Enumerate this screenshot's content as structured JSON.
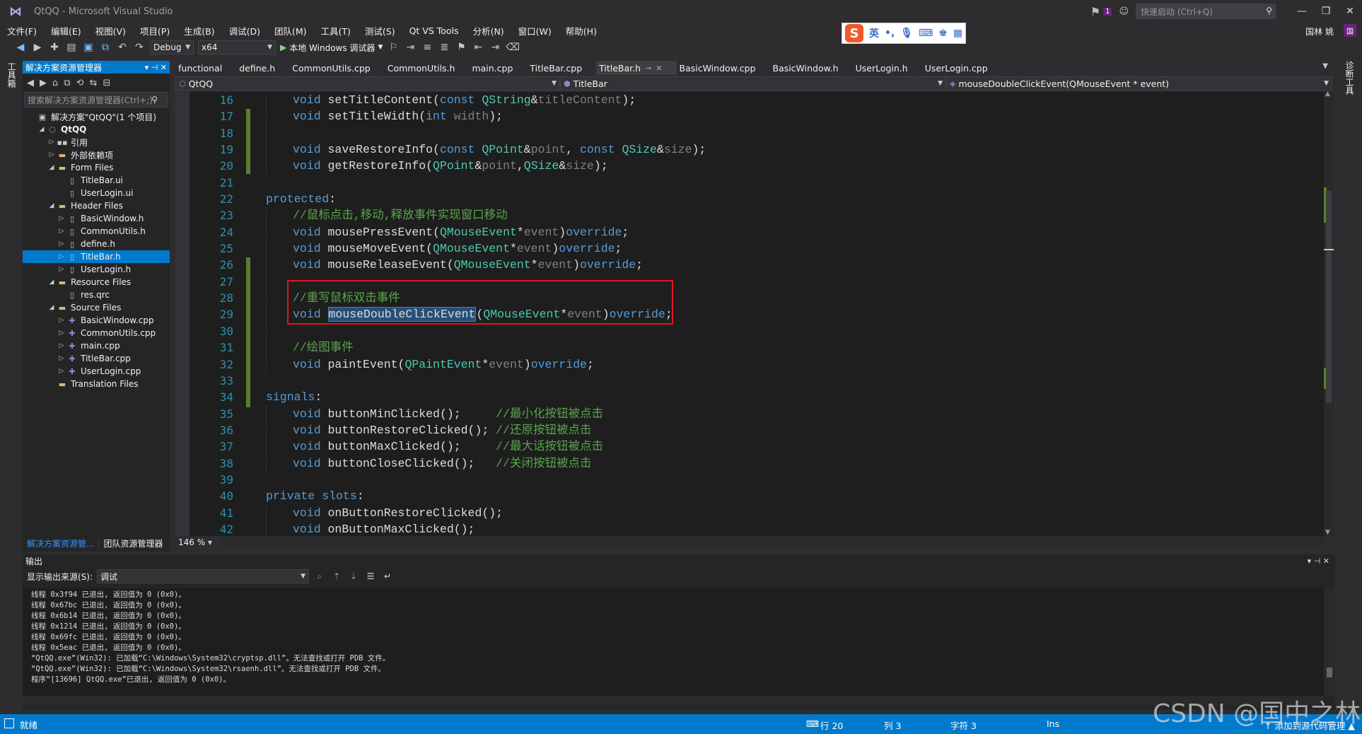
{
  "window": {
    "title": "QtQQ - Microsoft Visual Studio",
    "notification_count": "1",
    "quick_launch_placeholder": "快速启动 (Ctrl+Q)",
    "user_name": "国林 姚",
    "user_initial": "国"
  },
  "menu": [
    "文件(F)",
    "编辑(E)",
    "视图(V)",
    "项目(P)",
    "生成(B)",
    "调试(D)",
    "团队(M)",
    "工具(T)",
    "测试(S)",
    "Qt VS Tools",
    "分析(N)",
    "窗口(W)",
    "帮助(H)"
  ],
  "ime": {
    "logo": "S",
    "mode": "英"
  },
  "toolbar": {
    "config": "Debug",
    "platform": "x64",
    "run_label": "本地 Windows 调试器"
  },
  "left_strip": {
    "label": "工具箱"
  },
  "right_strip": {
    "label": "诊断工具"
  },
  "solution_explorer": {
    "title": "解决方案资源管理器",
    "search_placeholder": "搜索解决方案资源管理器(Ctrl+;)",
    "items": [
      {
        "label": "解决方案\"QtQQ\"(1 个项目)",
        "indent": 0,
        "twisty": "",
        "icon": "sol"
      },
      {
        "label": "QtQQ",
        "indent": 1,
        "twisty": "◢",
        "icon": "proj"
      },
      {
        "label": "引用",
        "indent": 2,
        "twisty": "▷",
        "icon": "ref"
      },
      {
        "label": "外部依赖项",
        "indent": 2,
        "twisty": "▷",
        "icon": "folder"
      },
      {
        "label": "Form Files",
        "indent": 2,
        "twisty": "◢",
        "icon": "folder"
      },
      {
        "label": "TitleBar.ui",
        "indent": 3,
        "twisty": "",
        "icon": "file"
      },
      {
        "label": "UserLogin.ui",
        "indent": 3,
        "twisty": "",
        "icon": "file"
      },
      {
        "label": "Header Files",
        "indent": 2,
        "twisty": "◢",
        "icon": "folder"
      },
      {
        "label": "BasicWindow.h",
        "indent": 3,
        "twisty": "▷",
        "icon": "file"
      },
      {
        "label": "CommonUtils.h",
        "indent": 3,
        "twisty": "▷",
        "icon": "file"
      },
      {
        "label": "define.h",
        "indent": 3,
        "twisty": "▷",
        "icon": "file"
      },
      {
        "label": "TitleBar.h",
        "indent": 3,
        "twisty": "▷",
        "icon": "file",
        "selected": true
      },
      {
        "label": "UserLogin.h",
        "indent": 3,
        "twisty": "▷",
        "icon": "file"
      },
      {
        "label": "Resource Files",
        "indent": 2,
        "twisty": "◢",
        "icon": "folder"
      },
      {
        "label": "res.qrc",
        "indent": 3,
        "twisty": "",
        "icon": "file"
      },
      {
        "label": "Source Files",
        "indent": 2,
        "twisty": "◢",
        "icon": "folder"
      },
      {
        "label": "BasicWindow.cpp",
        "indent": 3,
        "twisty": "▷",
        "icon": "cpp"
      },
      {
        "label": "CommonUtils.cpp",
        "indent": 3,
        "twisty": "▷",
        "icon": "cpp"
      },
      {
        "label": "main.cpp",
        "indent": 3,
        "twisty": "▷",
        "icon": "cpp"
      },
      {
        "label": "TitleBar.cpp",
        "indent": 3,
        "twisty": "▷",
        "icon": "cpp"
      },
      {
        "label": "UserLogin.cpp",
        "indent": 3,
        "twisty": "▷",
        "icon": "cpp"
      },
      {
        "label": "Translation Files",
        "indent": 2,
        "twisty": "",
        "icon": "folder"
      }
    ],
    "bottom_tabs": [
      "解决方案资源管...",
      "团队资源管理器"
    ]
  },
  "editor": {
    "tabs": [
      {
        "label": "functional"
      },
      {
        "label": "define.h"
      },
      {
        "label": "CommonUtils.cpp"
      },
      {
        "label": "CommonUtils.h"
      },
      {
        "label": "main.cpp"
      },
      {
        "label": "TitleBar.cpp"
      },
      {
        "label": "TitleBar.h",
        "active": true
      },
      {
        "label": "BasicWindow.cpp"
      },
      {
        "label": "BasicWindow.h"
      },
      {
        "label": "UserLogin.h"
      },
      {
        "label": "UserLogin.cpp"
      }
    ],
    "nav_project": "QtQQ",
    "nav_class": "TitleBar",
    "nav_member": "mouseDoubleClickEvent(QMouseEvent * event)",
    "zoom": "146 %",
    "lines": [
      {
        "n": "16",
        "ind": 1,
        "tokens": [
          [
            "kw",
            "void "
          ],
          [
            "fn",
            "setTitleContent("
          ],
          [
            "kw",
            "const "
          ],
          [
            "ty",
            "QString"
          ],
          [
            "fn",
            "&"
          ],
          [
            "pm",
            "titleContent"
          ],
          [
            "fn",
            ");"
          ]
        ]
      },
      {
        "n": "17",
        "ind": 1,
        "tokens": [
          [
            "kw",
            "void "
          ],
          [
            "fn",
            "setTitleWidth("
          ],
          [
            "kw",
            "int "
          ],
          [
            "pm",
            "width"
          ],
          [
            "fn",
            ");"
          ]
        ]
      },
      {
        "n": "18",
        "ind": 1,
        "tokens": []
      },
      {
        "n": "19",
        "ind": 1,
        "tokens": [
          [
            "kw",
            "void "
          ],
          [
            "fn",
            "saveRestoreInfo("
          ],
          [
            "kw",
            "const "
          ],
          [
            "ty",
            "QPoint"
          ],
          [
            "fn",
            "&"
          ],
          [
            "pm",
            "point"
          ],
          [
            "fn",
            ", "
          ],
          [
            "kw",
            "const "
          ],
          [
            "ty",
            "QSize"
          ],
          [
            "fn",
            "&"
          ],
          [
            "pm",
            "size"
          ],
          [
            "fn",
            ");"
          ]
        ]
      },
      {
        "n": "20",
        "ind": 1,
        "tokens": [
          [
            "kw",
            "void "
          ],
          [
            "fn",
            "getRestoreInfo("
          ],
          [
            "ty",
            "QPoint"
          ],
          [
            "fn",
            "&"
          ],
          [
            "pm",
            "point"
          ],
          [
            "fn",
            ","
          ],
          [
            "ty",
            "QSize"
          ],
          [
            "fn",
            "&"
          ],
          [
            "pm",
            "size"
          ],
          [
            "fn",
            ");"
          ]
        ]
      },
      {
        "n": "21",
        "ind": 0,
        "tokens": []
      },
      {
        "n": "22",
        "ind": 0,
        "tokens": [
          [
            "kw",
            "protected"
          ],
          [
            "fn",
            ":"
          ]
        ]
      },
      {
        "n": "23",
        "ind": 1,
        "tokens": [
          [
            "cm",
            "//鼠标点击,移动,释放事件实现窗口移动"
          ]
        ]
      },
      {
        "n": "24",
        "ind": 1,
        "tokens": [
          [
            "kw",
            "void "
          ],
          [
            "fn",
            "mousePressEvent("
          ],
          [
            "ty",
            "QMouseEvent"
          ],
          [
            "fn",
            "*"
          ],
          [
            "pm",
            "event"
          ],
          [
            "fn",
            ")"
          ],
          [
            "kw",
            "override"
          ],
          [
            "fn",
            ";"
          ]
        ]
      },
      {
        "n": "25",
        "ind": 1,
        "tokens": [
          [
            "kw",
            "void "
          ],
          [
            "fn",
            "mouseMoveEvent("
          ],
          [
            "ty",
            "QMouseEvent"
          ],
          [
            "fn",
            "*"
          ],
          [
            "pm",
            "event"
          ],
          [
            "fn",
            ")"
          ],
          [
            "kw",
            "override"
          ],
          [
            "fn",
            ";"
          ]
        ]
      },
      {
        "n": "26",
        "ind": 1,
        "tokens": [
          [
            "kw",
            "void "
          ],
          [
            "fn",
            "mouseReleaseEvent("
          ],
          [
            "ty",
            "QMouseEvent"
          ],
          [
            "fn",
            "*"
          ],
          [
            "pm",
            "event"
          ],
          [
            "fn",
            ")"
          ],
          [
            "kw",
            "override"
          ],
          [
            "fn",
            ";"
          ]
        ]
      },
      {
        "n": "27",
        "ind": 1,
        "tokens": []
      },
      {
        "n": "28",
        "ind": 1,
        "tokens": [
          [
            "cm",
            "//重写鼠标双击事件"
          ]
        ]
      },
      {
        "n": "29",
        "ind": 1,
        "tokens": [
          [
            "kw",
            "void "
          ],
          [
            "hl",
            "mouseDoubleClickEvent"
          ],
          [
            "fn",
            "("
          ],
          [
            "ty",
            "QMouseEvent"
          ],
          [
            "fn",
            "*"
          ],
          [
            "pm",
            "event"
          ],
          [
            "fn",
            ")"
          ],
          [
            "kw",
            "override"
          ],
          [
            "fn",
            ";"
          ]
        ]
      },
      {
        "n": "30",
        "ind": 1,
        "tokens": []
      },
      {
        "n": "31",
        "ind": 1,
        "tokens": [
          [
            "cm",
            "//绘图事件"
          ]
        ]
      },
      {
        "n": "32",
        "ind": 1,
        "tokens": [
          [
            "kw",
            "void "
          ],
          [
            "fn",
            "paintEvent("
          ],
          [
            "ty",
            "QPaintEvent"
          ],
          [
            "fn",
            "*"
          ],
          [
            "pm",
            "event"
          ],
          [
            "fn",
            ")"
          ],
          [
            "kw",
            "override"
          ],
          [
            "fn",
            ";"
          ]
        ]
      },
      {
        "n": "33",
        "ind": 0,
        "tokens": []
      },
      {
        "n": "34",
        "ind": 0,
        "tokens": [
          [
            "ac",
            "signals"
          ],
          [
            "fn",
            ":"
          ]
        ]
      },
      {
        "n": "35",
        "ind": 1,
        "tokens": [
          [
            "kw",
            "void "
          ],
          [
            "fn",
            "buttonMinClicked();     "
          ],
          [
            "cm",
            "//最小化按钮被点击"
          ]
        ]
      },
      {
        "n": "36",
        "ind": 1,
        "tokens": [
          [
            "kw",
            "void "
          ],
          [
            "fn",
            "buttonRestoreClicked(); "
          ],
          [
            "cm",
            "//还原按钮被点击"
          ]
        ]
      },
      {
        "n": "37",
        "ind": 1,
        "tokens": [
          [
            "kw",
            "void "
          ],
          [
            "fn",
            "buttonMaxClicked();     "
          ],
          [
            "cm",
            "//最大话按钮被点击"
          ]
        ]
      },
      {
        "n": "38",
        "ind": 1,
        "tokens": [
          [
            "kw",
            "void "
          ],
          [
            "fn",
            "buttonCloseClicked();   "
          ],
          [
            "cm",
            "//关闭按钮被点击"
          ]
        ]
      },
      {
        "n": "39",
        "ind": 0,
        "tokens": []
      },
      {
        "n": "40",
        "ind": 0,
        "tokens": [
          [
            "kw",
            "private "
          ],
          [
            "ac",
            "slots"
          ],
          [
            "fn",
            ":"
          ]
        ]
      },
      {
        "n": "41",
        "ind": 1,
        "tokens": [
          [
            "kw",
            "void "
          ],
          [
            "fn",
            "onButtonRestoreClicked();"
          ]
        ]
      },
      {
        "n": "42",
        "ind": 1,
        "tokens": [
          [
            "kw",
            "void "
          ],
          [
            "fn",
            "onButtonMaxClicked();"
          ]
        ]
      }
    ]
  },
  "output": {
    "title": "输出",
    "source_label": "显示输出来源(S):",
    "source_value": "调试",
    "lines": [
      "线程 0x3f94 已退出, 返回值为 0 (0x0)。",
      "线程 0x67bc 已退出, 返回值为 0 (0x0)。",
      "线程 0x6b14 已退出, 返回值为 0 (0x0)。",
      "线程 0x1214 已退出, 返回值为 0 (0x0)。",
      "线程 0x69fc 已退出, 返回值为 0 (0x0)。",
      "线程 0x5eac 已退出, 返回值为 0 (0x0)。",
      "“QtQQ.exe”(Win32): 已加载“C:\\Windows\\System32\\cryptsp.dll”。无法查找或打开 PDB 文件。",
      "“QtQQ.exe”(Win32): 已加载“C:\\Windows\\System32\\rsaenh.dll”。无法查找或打开 PDB 文件。",
      "程序“[13696] QtQQ.exe”已退出, 返回值为 0 (0x0)。"
    ]
  },
  "status": {
    "ready": "就绪",
    "line": "行 20",
    "col": "列 3",
    "char": "字符 3",
    "mode": "Ins",
    "source_control": "↑ 添加到源代码管理 ▲"
  },
  "watermark": "CSDN @国中之林",
  "colors": {
    "accent": "#007acc",
    "keyword": "#569cd6",
    "type": "#4ec9b0",
    "comment": "#57a64a",
    "param": "#808080",
    "highlight_box": "#e81123"
  }
}
